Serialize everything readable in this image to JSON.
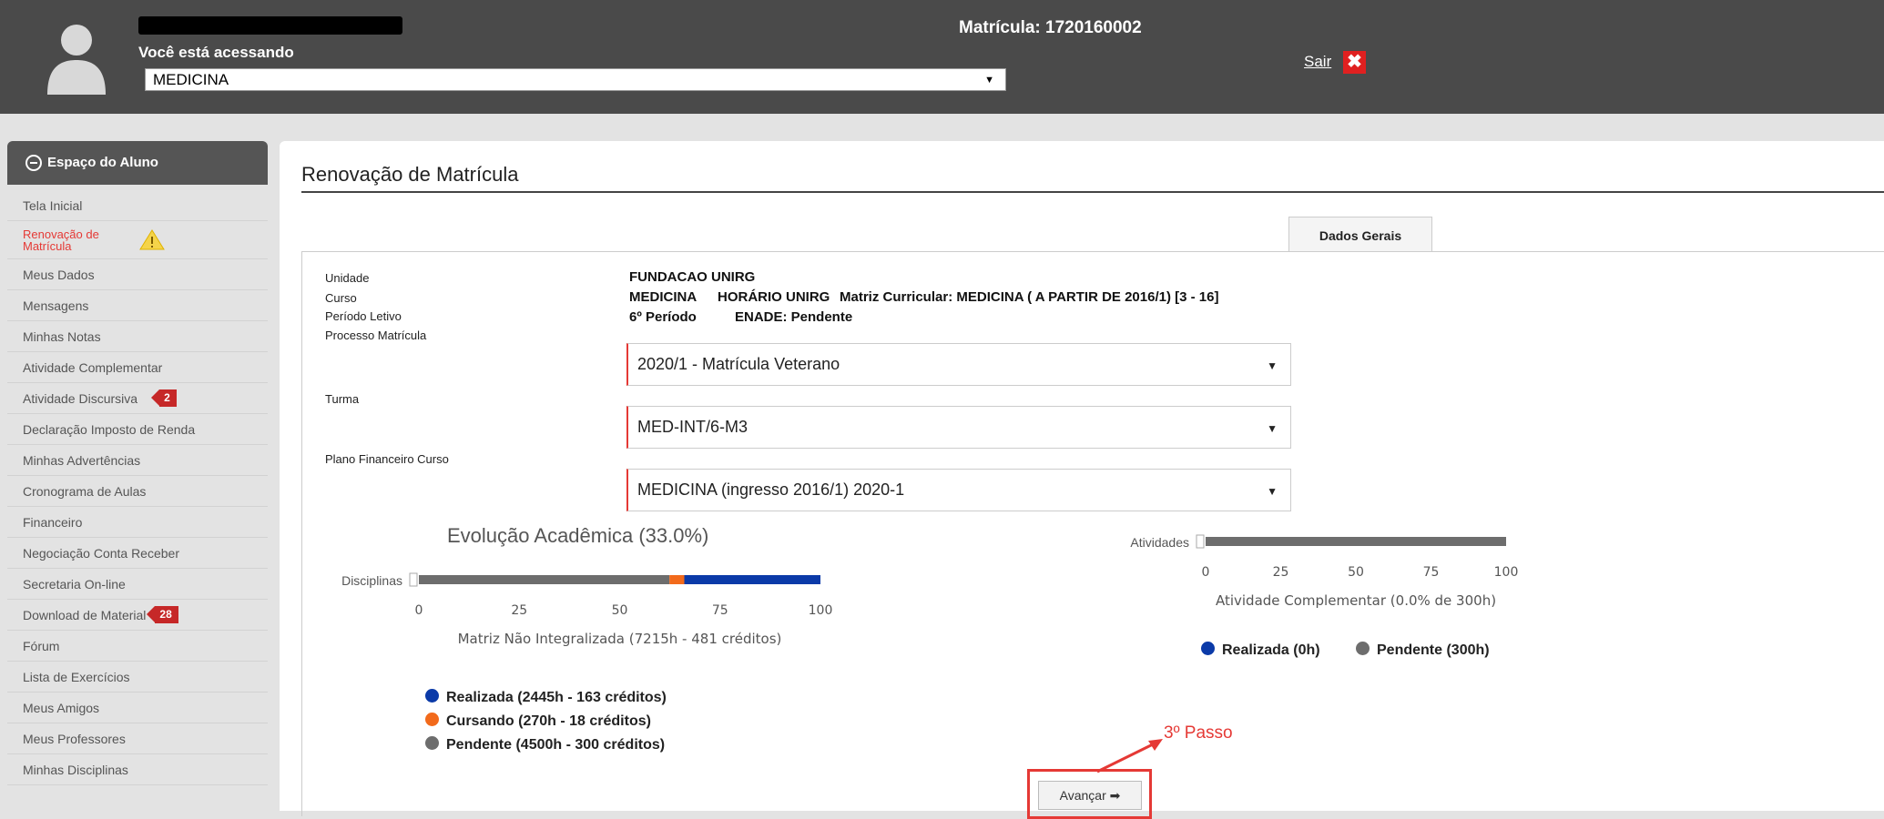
{
  "header": {
    "access_label": "Você está acessando",
    "course_selected": "MEDICINA",
    "matricula": "Matrícula: 1720160002",
    "sair_label": "Sair",
    "sair_icon": "✖"
  },
  "sidebar": {
    "title": "Espaço do Aluno",
    "items": [
      {
        "label": "Tela Inicial"
      },
      {
        "label": "Renovação de Matrícula"
      },
      {
        "label": "Meus Dados"
      },
      {
        "label": "Mensagens"
      },
      {
        "label": "Minhas Notas"
      },
      {
        "label": "Atividade Complementar"
      },
      {
        "label": "Atividade Discursiva",
        "badge": "2"
      },
      {
        "label": "Declaração Imposto de Renda"
      },
      {
        "label": "Minhas Advertências"
      },
      {
        "label": "Cronograma de Aulas"
      },
      {
        "label": "Financeiro"
      },
      {
        "label": "Negociação Conta Receber"
      },
      {
        "label": "Secretaria On-line"
      },
      {
        "label": "Download de Material",
        "badge": "28"
      },
      {
        "label": "Fórum"
      },
      {
        "label": "Lista de Exercícios"
      },
      {
        "label": "Meus Amigos"
      },
      {
        "label": "Meus Professores"
      },
      {
        "label": "Minhas Disciplinas"
      }
    ]
  },
  "main": {
    "title": "Renovação de Matrícula",
    "tab": "Dados Gerais",
    "labels": {
      "unidade": "Unidade",
      "curso": "Curso",
      "periodo": "Período Letivo",
      "processo": "Processo Matrícula",
      "turma": "Turma",
      "plano": "Plano Financeiro Curso"
    },
    "values": {
      "unidade": "FUNDACAO UNIRG",
      "curso": "MEDICINA",
      "horario": "HORÁRIO UNIRG",
      "matriz": "Matriz Curricular:  MEDICINA ( A PARTIR DE 2016/1) [3 - 16]",
      "periodo": "6º Período",
      "enade": "ENADE: Pendente"
    },
    "selects": {
      "processo": "2020/1 - Matrícula Veterano",
      "turma": "MED-INT/6-M3",
      "plano": "MEDICINA (ingresso 2016/1) 2020-1"
    },
    "annotation": "3º Passo",
    "next_button": "Avançar"
  },
  "colors": {
    "realizada": "#0b3aa8",
    "cursando": "#f26a1b",
    "pendente": "#6d6d6d",
    "accent": "#e53935"
  },
  "chart_data": [
    {
      "type": "bar",
      "title": "Evolução Acadêmica (33.0%)",
      "categories": [
        "Disciplinas"
      ],
      "xlabel": "Matriz Não Integralizada (7215h - 481 créditos)",
      "xlim": [
        0,
        100
      ],
      "xticks": [
        "0",
        "25",
        "50",
        "75",
        "100"
      ],
      "stacked_order": [
        "Pendente",
        "Cursando",
        "Realizada"
      ],
      "series": [
        {
          "name": "Realizada (2445h - 163 créditos)",
          "values": [
            33.9
          ]
        },
        {
          "name": "Cursando (270h - 18 créditos)",
          "values": [
            3.7
          ]
        },
        {
          "name": "Pendente (4500h - 300 créditos)",
          "values": [
            62.4
          ]
        }
      ]
    },
    {
      "type": "bar",
      "categories": [
        "Atividades"
      ],
      "xlabel": "Atividade Complementar (0.0% de 300h)",
      "xlim": [
        0,
        100
      ],
      "xticks": [
        "0",
        "25",
        "50",
        "75",
        "100"
      ],
      "stacked_order": [
        "Pendente",
        "Realizada"
      ],
      "series": [
        {
          "name": "Realizada (0h)",
          "values": [
            0
          ]
        },
        {
          "name": "Pendente (300h)",
          "values": [
            100
          ]
        }
      ]
    }
  ]
}
